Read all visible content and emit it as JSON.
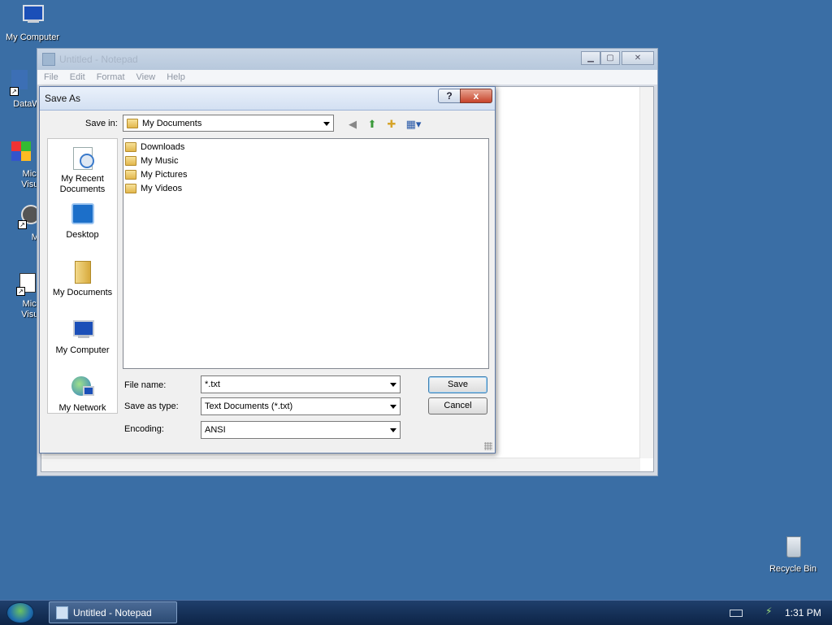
{
  "desktop": {
    "icons": [
      {
        "label": "My Computer"
      },
      {
        "label": "DataW"
      },
      {
        "label": "Micro Visual"
      },
      {
        "label": "Myp"
      },
      {
        "label": "Micro Visual"
      },
      {
        "label": "Recycle Bin"
      }
    ]
  },
  "notepad": {
    "title": "Untitled - Notepad",
    "menu": [
      "File",
      "Edit",
      "Format",
      "View",
      "Help"
    ]
  },
  "dialog": {
    "title": "Save As",
    "help_label": "?",
    "close_label": "x",
    "save_in_label": "Save in:",
    "save_in_value": "My Documents",
    "places": [
      {
        "label": "My Recent Documents",
        "icon": "recent-documents-icon"
      },
      {
        "label": "Desktop",
        "icon": "desktop-icon"
      },
      {
        "label": "My Documents",
        "icon": "my-documents-icon"
      },
      {
        "label": "My Computer",
        "icon": "my-computer-icon"
      },
      {
        "label": "My Network",
        "icon": "my-network-icon"
      }
    ],
    "files": [
      {
        "name": "Downloads",
        "icon": "folder-icon"
      },
      {
        "name": "My Music",
        "icon": "music-folder-icon"
      },
      {
        "name": "My Pictures",
        "icon": "pictures-folder-icon"
      },
      {
        "name": "My Videos",
        "icon": "videos-folder-icon"
      }
    ],
    "file_name_label": "File name:",
    "file_name_value": "*.txt",
    "save_as_type_label": "Save as type:",
    "save_as_type_value": "Text Documents (*.txt)",
    "encoding_label": "Encoding:",
    "encoding_value": "ANSI",
    "save_button": "Save",
    "cancel_button": "Cancel"
  },
  "taskbar": {
    "task_label": "Untitled - Notepad",
    "clock": "1:31 PM"
  },
  "colors": {
    "desktop": "#3a6ea5",
    "taskbar": "#14315a"
  }
}
